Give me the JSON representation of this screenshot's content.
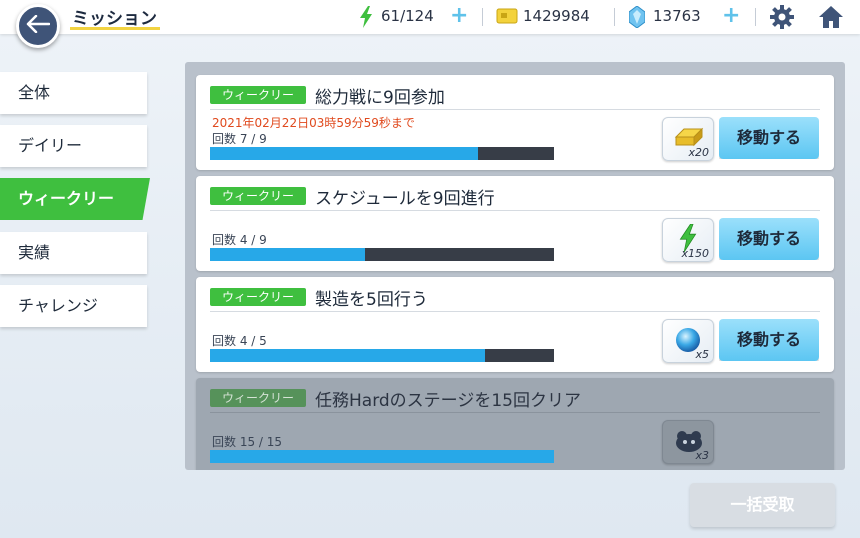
{
  "header": {
    "title": "ミッション",
    "stamina": "61/124",
    "gold": "1429984",
    "gems": "13763",
    "plus_symbol": "+"
  },
  "tabs": [
    {
      "label": "全体",
      "active": false
    },
    {
      "label": "デイリー",
      "active": false
    },
    {
      "label": "ウィークリー",
      "active": true
    },
    {
      "label": "実績",
      "active": false
    },
    {
      "label": "チャレンジ",
      "active": false
    }
  ],
  "missions": [
    {
      "badge": "ウィークリー",
      "title": "総力戦に9回参加",
      "deadline": "2021年02月22日03時59分59秒まで",
      "count": "回数 7 / 9",
      "progress": 0.78,
      "reward_icon": "gold-bar-icon",
      "reward_qty": "x20",
      "button": "移動する",
      "completed": false
    },
    {
      "badge": "ウィークリー",
      "title": "スケジュールを9回進行",
      "count": "回数 4 / 9",
      "progress": 0.45,
      "reward_icon": "stamina-bolt-icon",
      "reward_qty": "x150",
      "button": "移動する",
      "completed": false
    },
    {
      "badge": "ウィークリー",
      "title": "製造を5回行う",
      "count": "回数 4 / 5",
      "progress": 0.8,
      "reward_icon": "blue-orb-icon",
      "reward_qty": "x5",
      "button": "移動する",
      "completed": false
    },
    {
      "badge": "ウィークリー",
      "title": "任務Hardのステージを15回クリア",
      "count": "回数 15 / 15",
      "progress": 1.0,
      "reward_icon": "creature-icon",
      "reward_qty": "x3",
      "completed": true
    }
  ],
  "claim_all": "一括受取",
  "colors": {
    "accent_green": "#3fbf3f",
    "progress_blue": "#27a8e8",
    "deadline_red": "#e04a1e",
    "button_blue": "#5cc6f2"
  }
}
